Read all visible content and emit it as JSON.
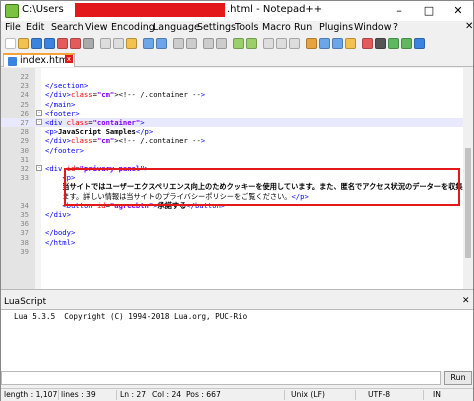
{
  "window": {
    "title_left": "C:\\Users",
    "title_right": ".html - Notepad++",
    "min_icon": "–",
    "max_icon": "□",
    "close_icon": "✕"
  },
  "menu": [
    "File",
    "Edit",
    "Search",
    "View",
    "Encoding",
    "Language",
    "Settings",
    "Tools",
    "Macro",
    "Run",
    "Plugins",
    "Window",
    "?"
  ],
  "menu_close": "✕",
  "tab": {
    "label": "index.html",
    "close": "x"
  },
  "editor": {
    "lines": [
      {
        "n": "22",
        "code": "",
        "fold": ""
      },
      {
        "n": "23",
        "code": "</section>",
        "fold": ""
      },
      {
        "n": "24",
        "code": "</div><!-- /.container -->",
        "fold": ""
      },
      {
        "n": "25",
        "code": "</main>",
        "fold": ""
      },
      {
        "n": "26",
        "code": "<footer>",
        "fold": "-"
      },
      {
        "n": "27",
        "code": "<div class=\"container\">",
        "fold": "-"
      },
      {
        "n": "28",
        "code": "<p>JavaScript Samples</p>",
        "fold": ""
      },
      {
        "n": "29",
        "code": "</div><!-- /.container -->",
        "fold": ""
      },
      {
        "n": "30",
        "code": "</footer>",
        "fold": ""
      },
      {
        "n": "31",
        "code": "",
        "fold": ""
      },
      {
        "n": "32",
        "code": "<div id=\"privary-panel\">",
        "fold": "-"
      },
      {
        "n": "33",
        "code": "    <p>",
        "fold": ""
      },
      {
        "n": "",
        "code": "    当サイトではユーザーエクスペリエンス向上のためクッキーを使用しています。また、匿名でアクセス状況のデーターを収集してい",
        "fold": ""
      },
      {
        "n": "",
        "code": "    ます。詳しい情報は当サイトのプライバシーポリシーをご覧ください。</p>",
        "fold": ""
      },
      {
        "n": "34",
        "code": "    <button id=\"agreebtn\">承諾する</button>",
        "fold": ""
      },
      {
        "n": "35",
        "code": "</div>",
        "fold": ""
      },
      {
        "n": "36",
        "code": "",
        "fold": ""
      },
      {
        "n": "37",
        "code": "</body>",
        "fold": ""
      },
      {
        "n": "38",
        "code": "</html>",
        "fold": ""
      },
      {
        "n": "39",
        "code": "",
        "fold": ""
      }
    ]
  },
  "lua": {
    "title": "LuaScript",
    "close": "✕",
    "output": "Lua 5.3.5  Copyright (C) 1994-2018 Lua.org, PUC-Rio",
    "run_label": "Run"
  },
  "status": {
    "length": "length : 1,107",
    "lines": "lines : 39",
    "ln": "Ln : 27",
    "col": "Col : 24",
    "pos": "Pos : 667",
    "eol": "Unix (LF)",
    "encoding": "UTF-8",
    "mode": "IN"
  },
  "colors": {
    "accent": "#f7a23b",
    "redaction": "#e2181b",
    "tag": "#0000ff",
    "attr": "#ff0000",
    "value": "#8000ff",
    "comment": "#008000"
  }
}
